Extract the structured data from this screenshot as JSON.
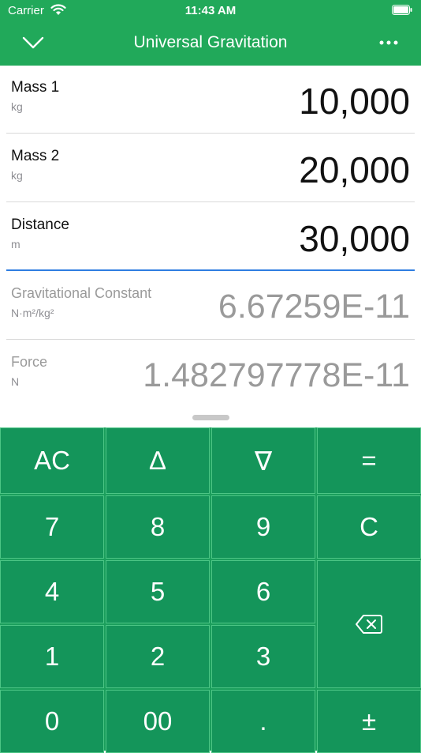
{
  "status_bar": {
    "carrier": "Carrier",
    "time": "11:43 AM",
    "wifi_icon": "wifi-icon",
    "battery_icon": "battery-icon"
  },
  "nav": {
    "title": "Universal Gravitation",
    "back_icon": "chevron-down-icon",
    "more_icon": "more-icon"
  },
  "rows": [
    {
      "label": "Mass 1",
      "unit": "kg",
      "value": "10,000"
    },
    {
      "label": "Mass 2",
      "unit": "kg",
      "value": "20,000"
    },
    {
      "label": "Distance",
      "unit": "m",
      "value": "30,000"
    },
    {
      "label": "Gravitational Constant",
      "unit": "N·m²/kg²",
      "value": "6.67259E-11"
    },
    {
      "label": "Force",
      "unit": "N",
      "value": "1.482797778E-11"
    }
  ],
  "keypad": {
    "ac": "AC",
    "up": "∆",
    "down": "∇",
    "equals": "=",
    "k7": "7",
    "k8": "8",
    "k9": "9",
    "clear": "C",
    "k4": "4",
    "k5": "5",
    "k6": "6",
    "backspace_icon": "backspace-icon",
    "k1": "1",
    "k2": "2",
    "k3": "3",
    "k0": "0",
    "k00": "00",
    "decimal": ".",
    "plus_minus": "±"
  },
  "colors": {
    "accent": "#21a95a",
    "keypad": "#14955a",
    "active_field_line": "#2f7de1"
  }
}
